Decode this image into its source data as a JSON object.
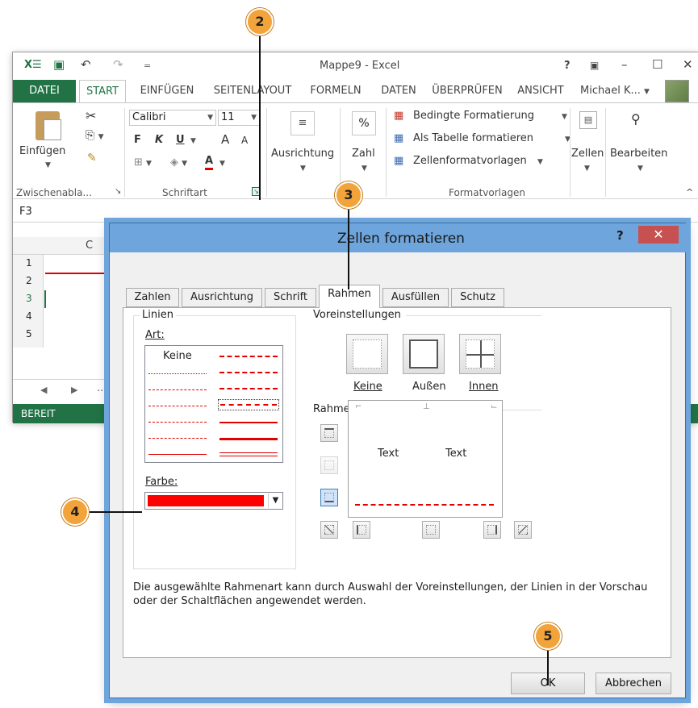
{
  "window": {
    "title": "Mappe9 - Excel",
    "help": "?",
    "restore": "▣",
    "minimize": "–",
    "maximize": "☐",
    "close": "✕"
  },
  "qat": {
    "undo": "↶",
    "redo": "↷",
    "more": "="
  },
  "ribbon_tabs": [
    "DATEI",
    "START",
    "EINFÜGEN",
    "SEITENLAYOUT",
    "FORMELN",
    "DATEN",
    "ÜBERPRÜFEN",
    "ANSICHT"
  ],
  "user": "Michael K...",
  "ribbon": {
    "clipboard": {
      "paste": "Einfügen",
      "label": "Zwischenabla..."
    },
    "font": {
      "name": "Calibri",
      "size": "11",
      "bold": "F",
      "italic": "K",
      "underline": "U",
      "grow": "A",
      "shrink": "A",
      "color": "A",
      "label": "Schriftart"
    },
    "alignment": {
      "label": "Ausrichtung"
    },
    "number": {
      "symbol": "%",
      "label": "Zahl"
    },
    "styles": {
      "conditional": "Bedingte Formatierung",
      "as_table": "Als Tabelle formatieren",
      "cell_styles": "Zellenformatvorlagen",
      "label": "Formatvorlagen"
    },
    "cells": {
      "label": "Zellen"
    },
    "editing": {
      "label": "Bearbeiten"
    }
  },
  "namebox": "F3",
  "sheet": {
    "col": "C",
    "rows": [
      "1",
      "2",
      "3",
      "4",
      "5"
    ],
    "values": [
      "2",
      "1"
    ]
  },
  "status": "BEREIT",
  "dialog": {
    "title": "Zellen formatieren",
    "help": "?",
    "close": "✕",
    "tabs": [
      "Zahlen",
      "Ausrichtung",
      "Schrift",
      "Rahmen",
      "Ausfüllen",
      "Schutz"
    ],
    "lines_group": "Linien",
    "style_label": "Art:",
    "none_style": "Keine",
    "color_label": "Farbe:",
    "color_value": "#ff0000",
    "presets_group": "Voreinstellungen",
    "presets": [
      "Keine",
      "Außen",
      "Innen"
    ],
    "border_group": "Rahmen",
    "preview_texts": [
      "Text",
      "Text"
    ],
    "hint": "Die ausgewählte Rahmenart kann durch Auswahl der Voreinstellungen, der Linien in der Vorschau oder der Schaltflächen angewendet werden.",
    "ok": "OK",
    "cancel": "Abbrechen"
  },
  "callouts": [
    "2",
    "3",
    "4",
    "5"
  ],
  "colors": {
    "excel_green": "#217346",
    "dialog_blue": "#6da5dc",
    "callout": "#f2a33a",
    "border_red": "#e00000"
  }
}
